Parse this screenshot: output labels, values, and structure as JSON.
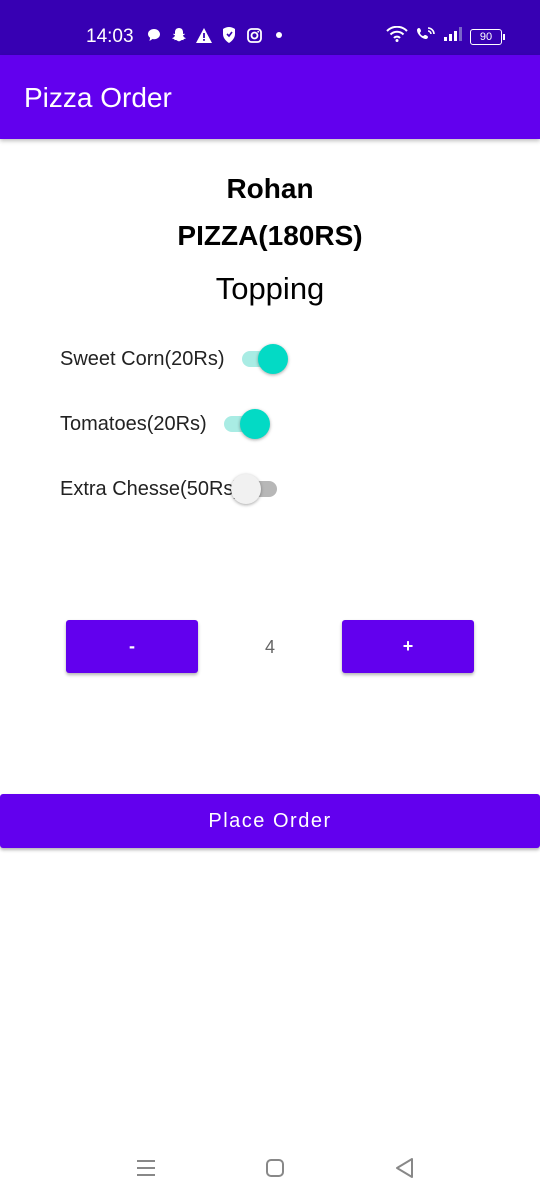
{
  "status_bar": {
    "time": "14:03",
    "battery": "90",
    "left_icons": [
      "chat-bubble-icon",
      "snapchat-icon",
      "warning-icon",
      "shield-icon",
      "instagram-icon",
      "dot-icon"
    ],
    "right_icons": [
      "wifi-icon",
      "wifi-calling-icon",
      "signal-icon",
      "battery-icon"
    ]
  },
  "app_bar": {
    "title": "Pizza Order"
  },
  "order": {
    "customer_name": "Rohan",
    "pizza_price": "PIZZA(180RS)",
    "topping_heading": "Topping"
  },
  "toppings": [
    {
      "label": "Sweet Corn(20Rs)",
      "checked": true
    },
    {
      "label": "Tomatoes(20Rs)",
      "checked": true
    },
    {
      "label": "Extra Chesse(50Rs)",
      "checked": false
    }
  ],
  "quantity": {
    "decrement_label": "-",
    "value": "4",
    "increment_label": "+"
  },
  "place_order_label": "Place Order",
  "colors": {
    "status_bar": "#3700b3",
    "primary": "#6200ee",
    "switch_on": "#03dac5",
    "switch_on_track": "#a9ece4",
    "switch_off_thumb": "#f1f1f1",
    "switch_off_track": "#b7b7b7"
  },
  "nav_bar": {
    "icons": [
      "recent-apps-icon",
      "home-icon",
      "back-icon"
    ]
  }
}
